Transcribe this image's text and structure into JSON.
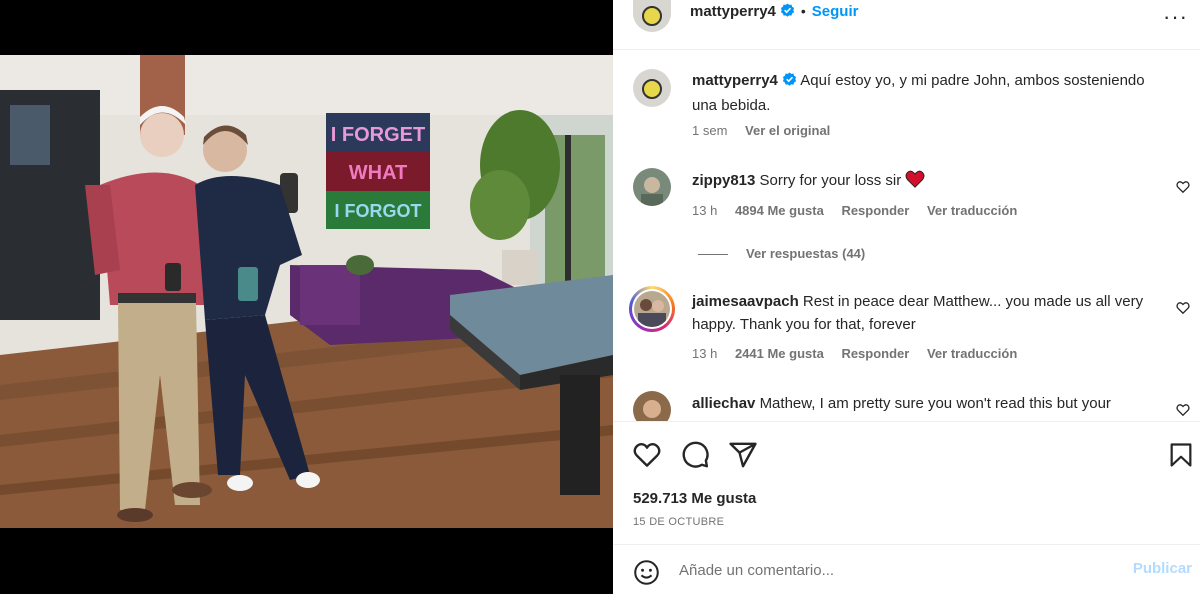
{
  "post": {
    "username": "mattyperry4",
    "follow_label": "Seguir",
    "dot": "•",
    "more": "···"
  },
  "caption": {
    "username": "mattyperry4",
    "text": "Aquí estoy yo, y mi padre John, ambos sosteniendo una bebida.",
    "time": "1 sem",
    "see_original": "Ver el original"
  },
  "comments": [
    {
      "username": "zippy813",
      "text": "Sorry for your loss sir",
      "emoji": "❤️",
      "time": "13 h",
      "likes": "4894 Me gusta",
      "reply": "Responder",
      "translate": "Ver traducción",
      "view_replies": "Ver respuestas (44)"
    },
    {
      "username": "jaimesaavpach",
      "text": "Rest in peace dear Matthew... you made us all very happy. Thank you for that, forever",
      "time": "13 h",
      "likes": "2441 Me gusta",
      "reply": "Responder",
      "translate": "Ver traducción"
    },
    {
      "username": "alliechav",
      "text": "Mathew, I am pretty sure you won't read this but your"
    }
  ],
  "like_count": "529.713 Me gusta",
  "date": "15 DE OCTUBRE",
  "composer": {
    "placeholder": "Añade un comentario...",
    "publish": "Publicar"
  },
  "artwork": {
    "line1": "I FORGET",
    "line2": "WHAT",
    "line3": "I FORGOT"
  },
  "colors": {
    "link": "#0095f6",
    "verified": "#0095f6",
    "publish_disabled": "#b3dbff",
    "muted": "#737373",
    "heart_red": "#ed4956"
  }
}
